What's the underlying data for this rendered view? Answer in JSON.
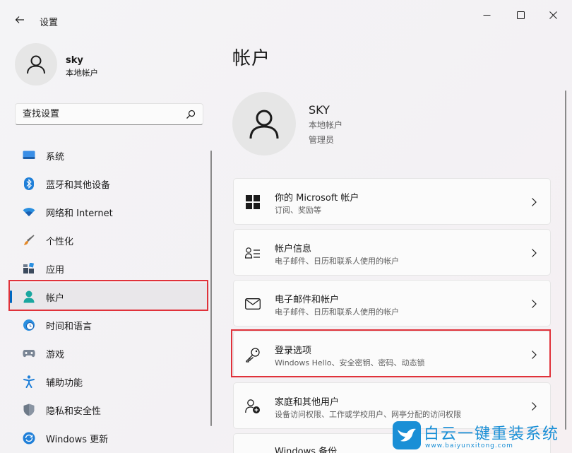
{
  "window": {
    "title": "设置"
  },
  "user": {
    "name": "sky",
    "type": "本地帐户"
  },
  "search": {
    "placeholder": "查找设置"
  },
  "nav": [
    {
      "label": "系统",
      "icon": "monitor-icon"
    },
    {
      "label": "蓝牙和其他设备",
      "icon": "bluetooth-icon"
    },
    {
      "label": "网络和 Internet",
      "icon": "wifi-icon"
    },
    {
      "label": "个性化",
      "icon": "brush-icon"
    },
    {
      "label": "应用",
      "icon": "apps-icon"
    },
    {
      "label": "帐户",
      "icon": "person-icon",
      "active": true
    },
    {
      "label": "时间和语言",
      "icon": "globe-clock-icon"
    },
    {
      "label": "游戏",
      "icon": "gamepad-icon"
    },
    {
      "label": "辅助功能",
      "icon": "accessibility-icon"
    },
    {
      "label": "隐私和安全性",
      "icon": "shield-icon"
    },
    {
      "label": "Windows 更新",
      "icon": "update-icon"
    }
  ],
  "page": {
    "title": "帐户"
  },
  "account": {
    "name": "SKY",
    "type": "本地帐户",
    "role": "管理员"
  },
  "cards": [
    {
      "title": "你的 Microsoft 帐户",
      "subtitle": "订阅、奖励等",
      "icon": "microsoft-logo-icon"
    },
    {
      "title": "帐户信息",
      "subtitle": "电子邮件、日历和联系人使用的帐户",
      "icon": "account-info-icon"
    },
    {
      "title": "电子邮件和帐户",
      "subtitle": "电子邮件、日历和联系人使用的帐户",
      "icon": "mail-icon"
    },
    {
      "title": "登录选项",
      "subtitle": "Windows Hello、安全密钥、密码、动态锁",
      "icon": "key-icon"
    },
    {
      "title": "家庭和其他用户",
      "subtitle": "设备访问权限、工作或学校用户、网亭分配的访问权限",
      "icon": "family-icon"
    },
    {
      "title": "Windows 备份",
      "subtitle": "",
      "icon": "backup-icon"
    }
  ],
  "watermark": {
    "title": "白云一键重装系统",
    "url": "www.baiyunxitong.com"
  },
  "colors": {
    "accent": "#0067c0",
    "highlight": "#e0323a",
    "watermark": "#1a8fd6"
  }
}
